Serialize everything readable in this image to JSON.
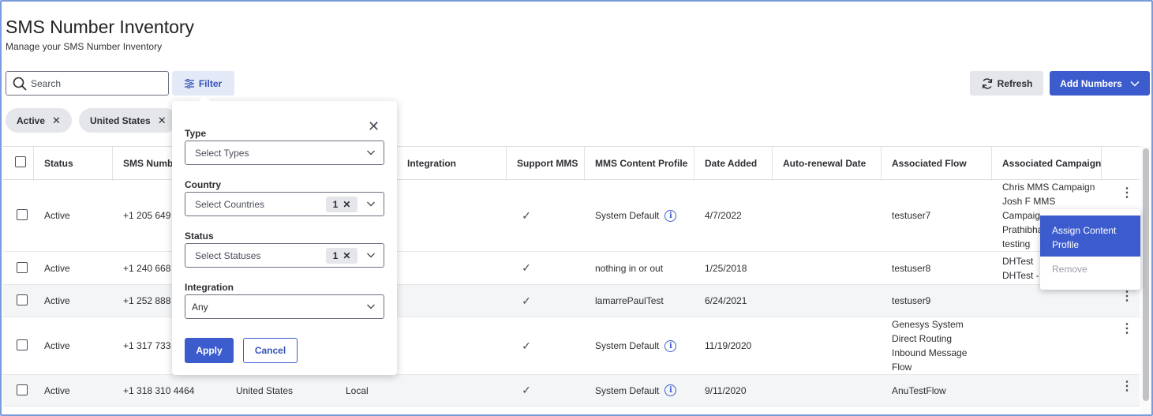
{
  "header": {
    "title": "SMS Number Inventory",
    "subtitle": "Manage your SMS Number Inventory"
  },
  "toolbar": {
    "search_placeholder": "Search",
    "filter_label": "Filter",
    "refresh_label": "Refresh",
    "add_numbers_label": "Add Numbers"
  },
  "chips": [
    "Active",
    "United States"
  ],
  "table": {
    "columns": [
      "Status",
      "SMS Number",
      "Integration",
      "Support MMS",
      "MMS Content Profile",
      "Date Added",
      "Auto-renewal Date",
      "Associated Flow",
      "Associated Campaign"
    ],
    "rows": [
      {
        "status": "Active",
        "number": "+1 205 649",
        "country": "",
        "type": "",
        "mms": "✓",
        "profile": "System Default",
        "profile_info": true,
        "date_added": "4/7/2022",
        "renewal": "",
        "flow": [
          "testuser7"
        ],
        "campaign": [
          "Chris MMS Campaign",
          "Josh F MMS",
          "Campaig",
          "Prathibha",
          "testing"
        ]
      },
      {
        "status": "Active",
        "number": "+1 240 668",
        "country": "",
        "type": "",
        "mms": "✓",
        "profile": "nothing in or out",
        "profile_info": false,
        "date_added": "1/25/2018",
        "renewal": "",
        "flow": [
          "testuser8"
        ],
        "campaign": [
          "DHTest",
          "DHTest -"
        ]
      },
      {
        "status": "Active",
        "number": "+1 252 888",
        "country": "",
        "type": "",
        "mms": "✓",
        "profile": "lamarrePaulTest",
        "profile_info": false,
        "date_added": "6/24/2021",
        "renewal": "",
        "flow": [
          "testuser9"
        ],
        "campaign": []
      },
      {
        "status": "Active",
        "number": "+1 317 733",
        "country": "",
        "type": "",
        "mms": "✓",
        "profile": "System Default",
        "profile_info": true,
        "date_added": "11/19/2020",
        "renewal": "",
        "flow": [
          "Genesys System",
          "Direct Routing",
          "Inbound Message",
          "Flow"
        ],
        "campaign": []
      },
      {
        "status": "Active",
        "number": "+1 318 310 4464",
        "country": "United States",
        "type": "Local",
        "mms": "✓",
        "profile": "System Default",
        "profile_info": true,
        "date_added": "9/11/2020",
        "renewal": "",
        "flow": [
          "AnuTestFlow"
        ],
        "campaign": []
      }
    ]
  },
  "filter_panel": {
    "type_label": "Type",
    "type_placeholder": "Select Types",
    "country_label": "Country",
    "country_placeholder": "Select Countries",
    "country_count": "1",
    "status_label": "Status",
    "status_placeholder": "Select Statuses",
    "status_count": "1",
    "integration_label": "Integration",
    "integration_value": "Any",
    "apply_label": "Apply",
    "cancel_label": "Cancel"
  },
  "context_menu": {
    "assign_label": "Assign Content Profile",
    "remove_label": "Remove"
  },
  "colors": {
    "accent": "#3c5ccd",
    "frame": "#7a9bdc"
  }
}
